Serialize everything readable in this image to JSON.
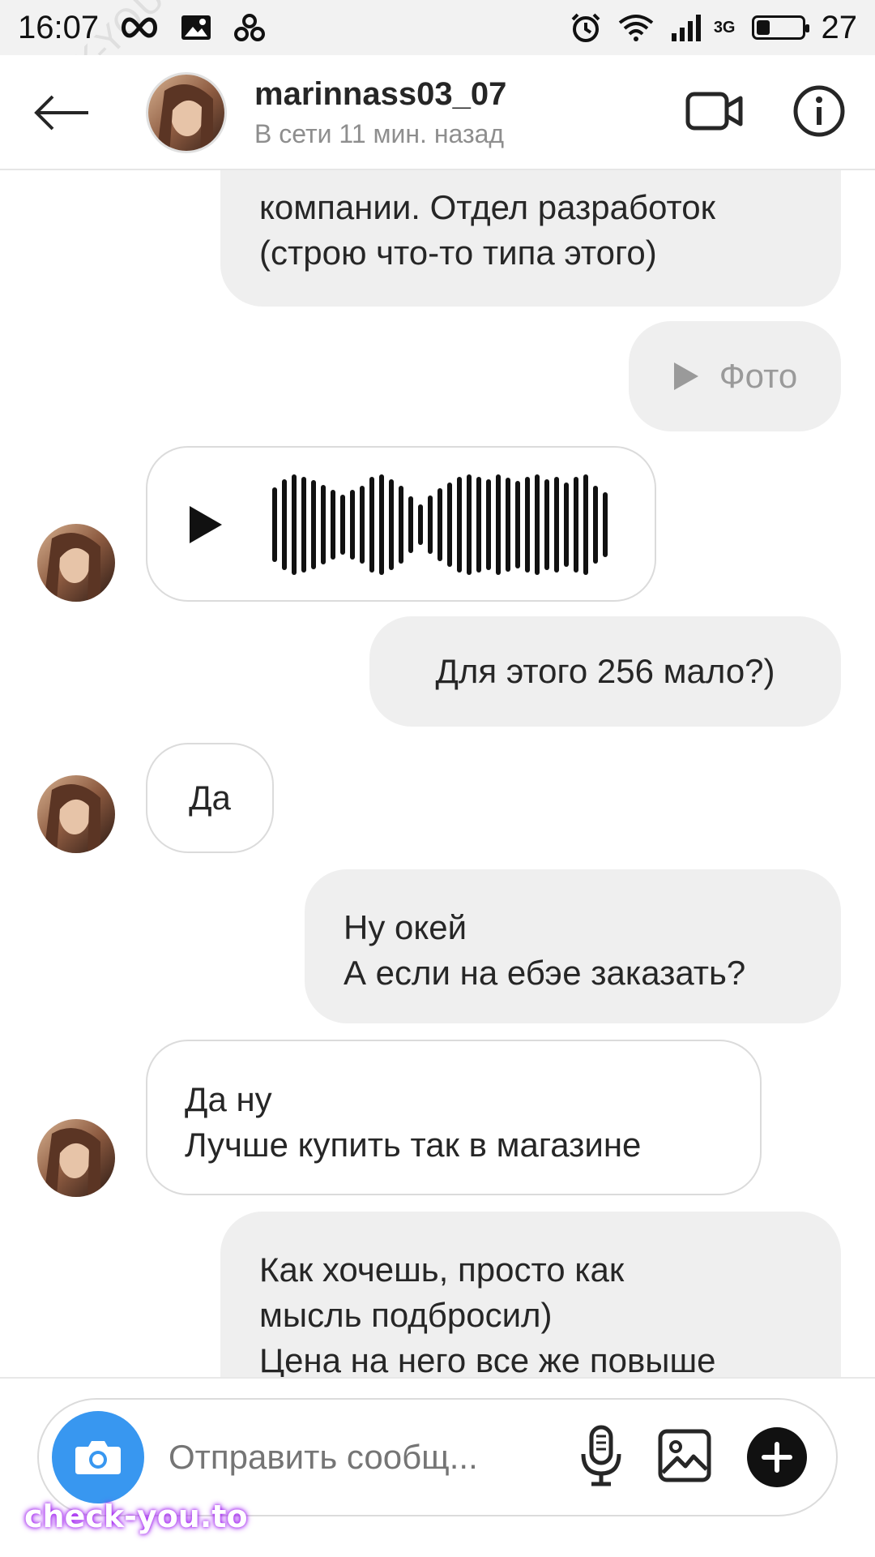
{
  "statusbar": {
    "time": "16:07",
    "network_label": "3G",
    "battery_text": "27",
    "battery_level": 0.27
  },
  "header": {
    "username": "marinnass03_07",
    "status": "В сети 11 мин. назад"
  },
  "watermark": "CHECK-YOU.ME",
  "messages": {
    "m1": "Работаю в строительной компании. Отдел разработок (строю что-то типа этого)",
    "m1_line1": "компании. Отдел разработок",
    "m1_line2": "(строю что-то типа этого)",
    "m2_label": "Фото",
    "m4": "Для этого 256 мало?)",
    "m5": "Да",
    "m6_line1": "Ну окей",
    "m6_line2": "А если на ебэе заказать?",
    "m7_line1": "Да ну",
    "m7_line2": "Лучше купить так в магазине",
    "m8_line1": "Как хочешь, просто как",
    "m8_line2": "мысль подбросил)",
    "m8_line3": "Цена на него все же повыше"
  },
  "composer": {
    "placeholder": "Отправить сообщ..."
  },
  "brand": "check-you.to",
  "colors": {
    "accent": "#3897f0",
    "outgoing_bubble": "#efefef",
    "incoming_border": "#dbdbdb"
  },
  "icons": {
    "back": "arrow-left-icon",
    "video": "video-camera-icon",
    "info": "info-icon",
    "play": "play-icon",
    "camera": "camera-icon",
    "mic": "microphone-icon",
    "gallery": "image-icon",
    "plus": "plus-icon"
  }
}
